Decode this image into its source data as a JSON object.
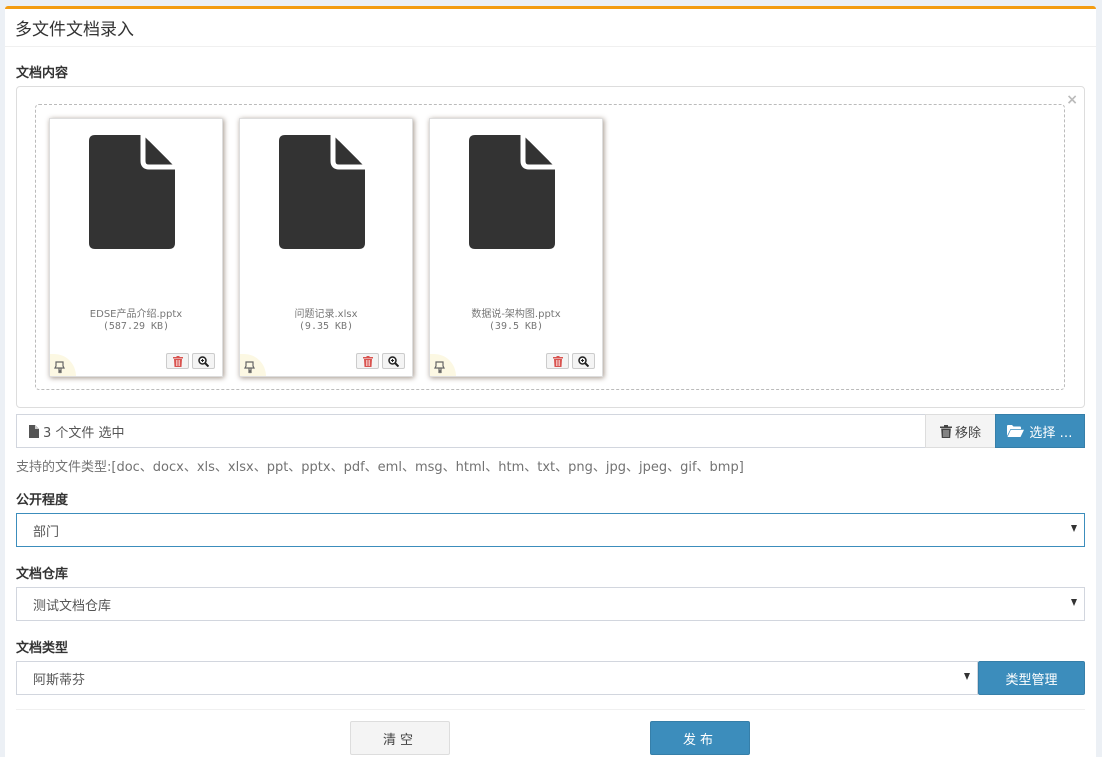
{
  "page": {
    "title": "多文件文档录入"
  },
  "content_section": {
    "label": "文档内容",
    "close_symbol": "×",
    "files": [
      {
        "name": "EDSE产品介绍.pptx",
        "size": "(587.29 KB)",
        "icon": "file-icon"
      },
      {
        "name": "问题记录.xlsx",
        "size": "(9.35 KB)",
        "icon": "file-icon"
      },
      {
        "name": "数据说-架构图.pptx",
        "size": "(39.5 KB)",
        "icon": "file-icon"
      }
    ],
    "caption": "3 个文件 选中",
    "remove_label": "移除",
    "browse_label": "选择 …",
    "hint": "支持的文件类型:[doc、docx、xls、xlsx、ppt、pptx、pdf、eml、msg、html、htm、txt、png、jpg、jpeg、gif、bmp]"
  },
  "visibility": {
    "label": "公开程度",
    "selected": "部门"
  },
  "repository": {
    "label": "文档仓库",
    "selected": "测试文档仓库"
  },
  "doc_type": {
    "label": "文档类型",
    "selected": "阿斯蒂芬",
    "manage_label": "类型管理"
  },
  "actions": {
    "clear_label": "清空",
    "publish_label": "发布"
  },
  "colors": {
    "accent": "#f39c12",
    "primary": "#3c8dbc"
  }
}
